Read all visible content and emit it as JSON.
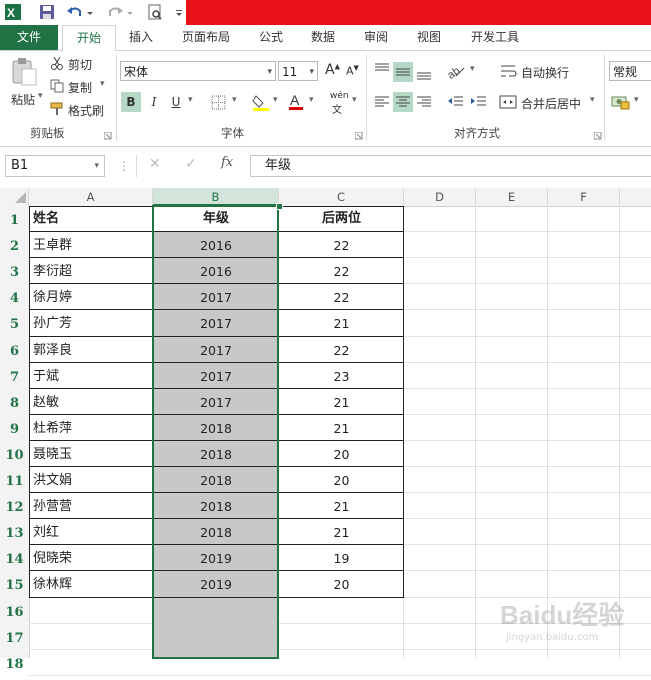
{
  "quick_access": {
    "icons": [
      "excel-logo-icon",
      "save-icon",
      "undo-icon",
      "redo-icon",
      "print-preview-icon",
      "customize-icon"
    ]
  },
  "tabs": [
    "文件",
    "开始",
    "插入",
    "页面布局",
    "公式",
    "数据",
    "审阅",
    "视图",
    "开发工具"
  ],
  "ribbon": {
    "clipboard": {
      "paste": "粘贴",
      "cut": "剪切",
      "copy": "复制",
      "format_painter": "格式刷",
      "label": "剪贴板"
    },
    "font": {
      "name": "宋体",
      "size": "11",
      "bold": "B",
      "italic": "I",
      "underline": "U",
      "phonetic": "wén",
      "label": "字体"
    },
    "alignment": {
      "wrap": "自动换行",
      "merge": "合并后居中",
      "label": "对齐方式"
    },
    "number": {
      "format": "常规"
    }
  },
  "formula_bar": {
    "name_box": "B1",
    "fx": "fx",
    "formula": "年级"
  },
  "colors": {
    "excel_green": "#217346",
    "selection_fill": "#c8c8c8",
    "title_red": "#e81119",
    "row_header_text": "#217346"
  },
  "columns": [
    "A",
    "B",
    "C",
    "D",
    "E",
    "F"
  ],
  "rows": [
    "1",
    "2",
    "3",
    "4",
    "5",
    "6",
    "7",
    "8",
    "9",
    "10",
    "11",
    "12",
    "13",
    "14",
    "15",
    "16",
    "17",
    "18"
  ],
  "table": {
    "headers": [
      "姓名",
      "年级",
      "后两位"
    ],
    "data": [
      [
        "王卓群",
        "2016",
        "22"
      ],
      [
        "李衍超",
        "2016",
        "22"
      ],
      [
        "徐月婷",
        "2017",
        "22"
      ],
      [
        "孙广芳",
        "2017",
        "21"
      ],
      [
        "郭泽良",
        "2017",
        "22"
      ],
      [
        "于斌",
        "2017",
        "23"
      ],
      [
        "赵敏",
        "2017",
        "21"
      ],
      [
        "杜希萍",
        "2018",
        "21"
      ],
      [
        "聂晓玉",
        "2018",
        "20"
      ],
      [
        "洪文娟",
        "2018",
        "20"
      ],
      [
        "孙营营",
        "2018",
        "21"
      ],
      [
        "刘红",
        "2018",
        "21"
      ],
      [
        "倪晓荣",
        "2019",
        "19"
      ],
      [
        "徐林辉",
        "2019",
        "20"
      ]
    ]
  },
  "watermark": {
    "text": "Baidu经验",
    "url": "jingyan.baidu.com"
  }
}
